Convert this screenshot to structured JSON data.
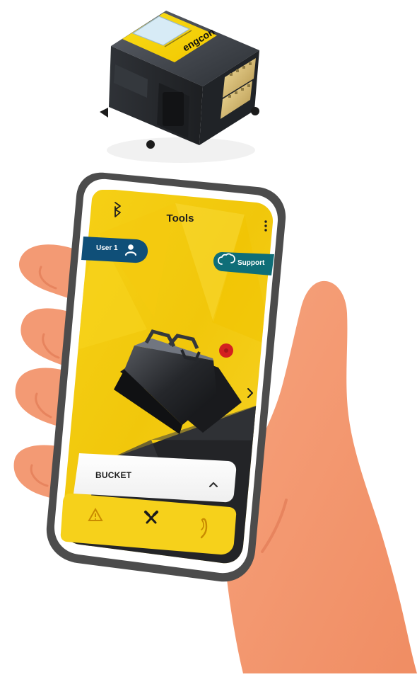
{
  "device": {
    "brand_label": "engcon"
  },
  "app": {
    "title": "Tools",
    "user_button_label": "User 1",
    "support_button_label": "Support",
    "tool_name": "BUCKET",
    "nav": {
      "items": [
        "warning",
        "tools",
        "tiltrotator"
      ]
    }
  },
  "colors": {
    "brand_yellow": "#F7D000",
    "panel_blue": "#0F4F78",
    "support_teal": "#0F6E78",
    "alert_red": "#D32020",
    "phone_frame": "#555555",
    "skin": "#F39A74",
    "skin_shadow": "#E7845E"
  },
  "icons": {
    "top_left": "bluetooth-icon",
    "top_right": "more-vertical-icon",
    "user": "person-icon",
    "support": "cloud-icon",
    "next": "chevron-right-icon",
    "collapse": "chevron-up-icon"
  }
}
